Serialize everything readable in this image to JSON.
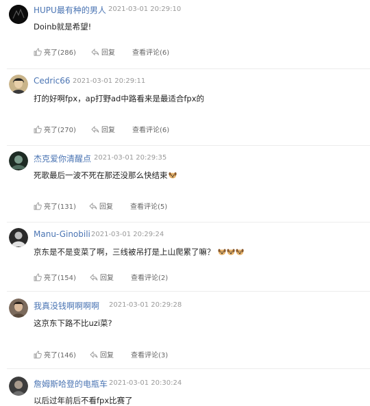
{
  "comments": [
    {
      "user": "HUPU最有种的男人",
      "time": "2021-03-01 20:29:10",
      "text": "Doinb就是希望!",
      "emojis": "",
      "like": "亮了(286)",
      "reply": "回复",
      "view": "查看评论(6)"
    },
    {
      "user": "Cedric66",
      "time": "2021-03-01 20:29:11",
      "text": "打的好啊fpx，ap打野ad中路看来是最适合fpx的",
      "emojis": "",
      "like": "亮了(270)",
      "reply": "回复",
      "view": "查看评论(6)"
    },
    {
      "user": "杰克爱你清醒点",
      "time": "2021-03-01 20:29:35",
      "text": "死歌最后一波不死在那还没那么快结束",
      "emojis": "dog",
      "like": "亮了(131)",
      "reply": "回复",
      "view": "查看评论(5)"
    },
    {
      "user": "Manu-Ginobili",
      "time": "2021-03-01 20:29:24",
      "text": "京东是不是变菜了啊，三线被吊打是上山爬累了嘛？",
      "emojis": "dog dog dog",
      "like": "亮了(154)",
      "reply": "回复",
      "view": "查看评论(2)"
    },
    {
      "user": "我真没钱啊啊啊啊",
      "time": "2021-03-01 20:29:28",
      "text": "这京东下路不比uzi菜?",
      "emojis": "",
      "like": "亮了(146)",
      "reply": "回复",
      "view": "查看评论(3)"
    },
    {
      "user": "詹姆斯哈登的电瓶车",
      "time": "2021-03-01 20:30:24",
      "text": "以后过年前后不看fpx比赛了",
      "emojis": "",
      "like": "",
      "reply": "",
      "view": ""
    }
  ]
}
